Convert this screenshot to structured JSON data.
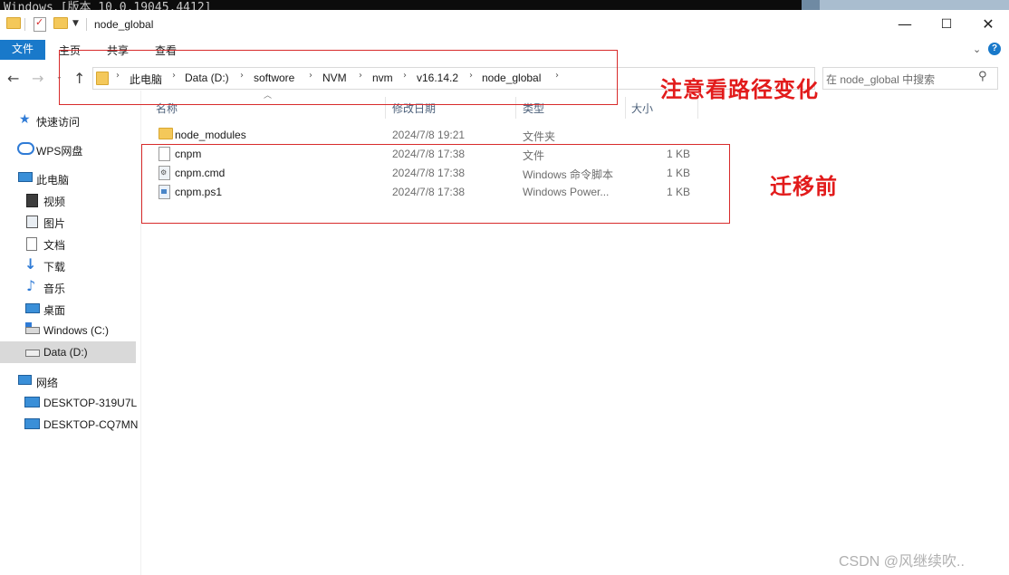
{
  "console": {
    "text": "Windows [版本 10.0.19045.4412]"
  },
  "window": {
    "title": "node_global",
    "controls": {
      "minimize": "—",
      "maximize": "☐",
      "close": "✕"
    }
  },
  "ribbon": {
    "tabs": [
      "文件",
      "主页",
      "共享",
      "查看"
    ]
  },
  "address": {
    "crumbs": [
      "此电脑",
      "Data (D:)",
      "softwore",
      "NVM",
      "nvm",
      "v16.14.2",
      "node_global"
    ],
    "search_placeholder": "在 node_global 中搜索"
  },
  "nav_pane": {
    "items": [
      {
        "label": "快速访问",
        "icon": "star-icon"
      },
      {
        "label": "WPS网盘",
        "icon": "cloud-icon"
      },
      {
        "label": "此电脑",
        "icon": "computer-icon"
      },
      {
        "label": "视频",
        "icon": "video-icon"
      },
      {
        "label": "图片",
        "icon": "picture-icon"
      },
      {
        "label": "文档",
        "icon": "document-icon"
      },
      {
        "label": "下载",
        "icon": "download-icon"
      },
      {
        "label": "音乐",
        "icon": "music-icon"
      },
      {
        "label": "桌面",
        "icon": "desktop-icon"
      },
      {
        "label": "Windows (C:)",
        "icon": "drive-icon"
      },
      {
        "label": "Data (D:)",
        "icon": "drive-icon"
      },
      {
        "label": "网络",
        "icon": "network-icon"
      },
      {
        "label": "DESKTOP-319U7L",
        "icon": "monitor-icon"
      },
      {
        "label": "DESKTOP-CQ7MN",
        "icon": "monitor-icon"
      }
    ]
  },
  "columns": {
    "name": "名称",
    "modified": "修改日期",
    "type": "类型",
    "size": "大小"
  },
  "files": [
    {
      "name": "node_modules",
      "modified": "2024/7/8 19:21",
      "type": "文件夹",
      "size": ""
    },
    {
      "name": "cnpm",
      "modified": "2024/7/8 17:38",
      "type": "文件",
      "size": "1 KB"
    },
    {
      "name": "cnpm.cmd",
      "modified": "2024/7/8 17:38",
      "type": "Windows 命令脚本",
      "size": "1 KB"
    },
    {
      "name": "cnpm.ps1",
      "modified": "2024/7/8 17:38",
      "type": "Windows Power...",
      "size": "1 KB"
    }
  ],
  "annotations": {
    "path_note": "注意看路径变化",
    "files_note": "迁移前"
  },
  "watermark": "CSDN @风继续吹..",
  "colors": {
    "accent": "#1979ca",
    "annotation": "#e21b1b"
  }
}
